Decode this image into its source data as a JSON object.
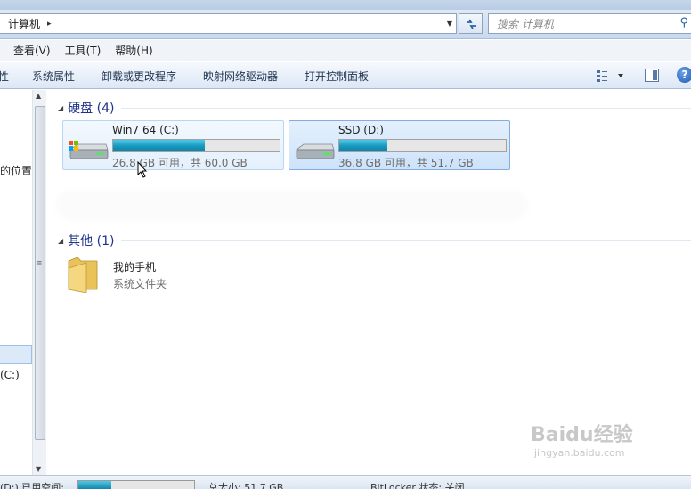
{
  "address": {
    "location": "计算机",
    "separator": "▸"
  },
  "search": {
    "placeholder": "搜索 计算机"
  },
  "menu": [
    {
      "label": "查看(V)"
    },
    {
      "label": "工具(T)"
    },
    {
      "label": "帮助(H)"
    }
  ],
  "commands": [
    {
      "label": "性"
    },
    {
      "label": "系统属性"
    },
    {
      "label": "卸载或更改程序"
    },
    {
      "label": "映射网络驱动器"
    },
    {
      "label": "打开控制面板"
    }
  ],
  "help": {
    "label": "?"
  },
  "nav": {
    "partial_1": "的位置",
    "partial_2": "(C:)"
  },
  "groups": {
    "hdd": {
      "title": "硬盘 (4)"
    },
    "other": {
      "title": "其他 (1)"
    }
  },
  "drives": [
    {
      "name": "Win7 64 (C:)",
      "info": "26.8 GB 可用，共 60.0 GB",
      "used_fraction": 0.553,
      "selected": false
    },
    {
      "name": "SSD (D:)",
      "info": "36.8 GB 可用，共 51.7 GB",
      "used_fraction": 0.288,
      "selected": true
    }
  ],
  "other_items": [
    {
      "name": "我的手机",
      "type": "系统文件夹"
    }
  ],
  "status": {
    "drive_label": "(D:) 已用空间:",
    "used_fraction": 0.288,
    "total": "总大小: 51.7 GB",
    "bitlocker": "BitLocker 状态: 关闭"
  },
  "watermark": {
    "logo": "Baidu经验",
    "site": "jingyan.baidu.com"
  },
  "colors": {
    "bar_fill": "#1a9cc2",
    "group_title": "#1e3287"
  }
}
